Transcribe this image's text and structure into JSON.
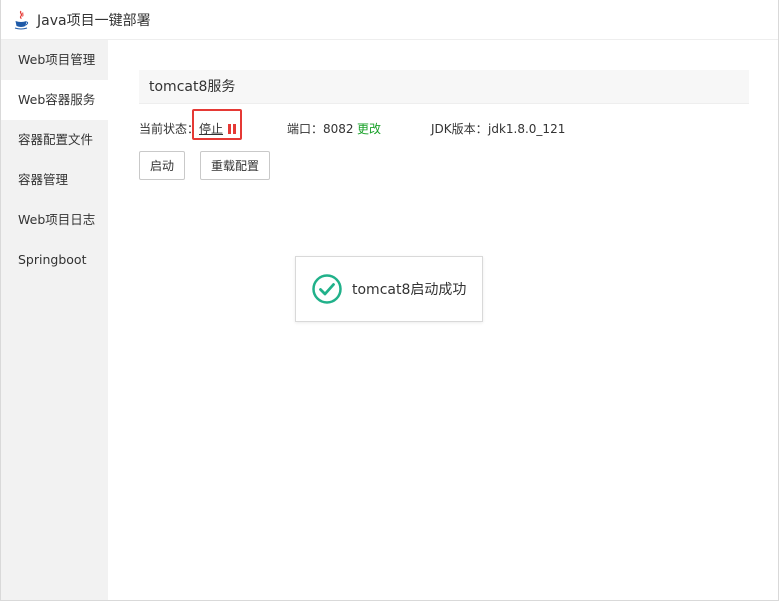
{
  "window": {
    "title": "Java项目一键部署"
  },
  "sidebar": {
    "items": [
      {
        "label": "Web项目管理",
        "active": false
      },
      {
        "label": "Web容器服务",
        "active": true
      },
      {
        "label": "容器配置文件",
        "active": false
      },
      {
        "label": "容器管理",
        "active": false
      },
      {
        "label": "Web项目日志",
        "active": false
      },
      {
        "label": "Springboot",
        "active": false
      }
    ]
  },
  "service": {
    "title": "tomcat8服务",
    "status_label": "当前状态：",
    "status_value": "停止",
    "port_label": "端口：",
    "port_value": "8082",
    "port_edit": "更改",
    "jdk_label": "JDK版本：",
    "jdk_value": "jdk1.8.0_121"
  },
  "buttons": {
    "start": "启动",
    "reload": "重载配置"
  },
  "toast": {
    "message": "tomcat8启动成功"
  },
  "colors": {
    "accent_green": "#1aa12a",
    "success_teal": "#21b18a",
    "highlight_red": "#e53935",
    "sidebar_bg": "#f2f2f2"
  },
  "icons": {
    "app": "java-coffee-icon",
    "status": "pause-icon",
    "toast": "check-circle-icon"
  }
}
